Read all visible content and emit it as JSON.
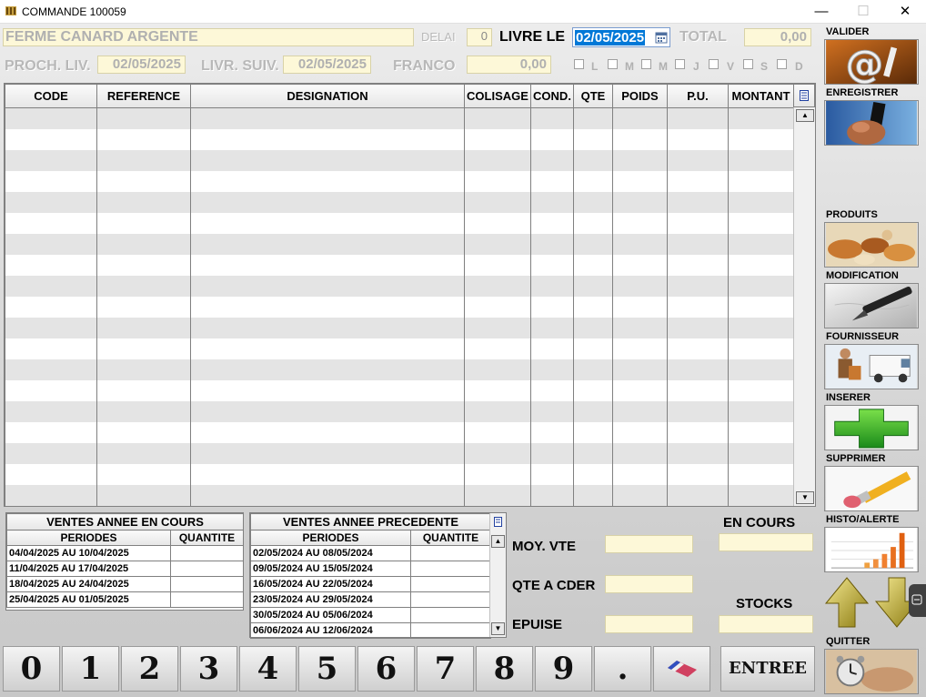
{
  "window": {
    "title": "COMMANDE 100059",
    "min_glyph": "—",
    "max_glyph": "☐",
    "close_glyph": "✕"
  },
  "header": {
    "supplier": "FERME CANARD ARGENTE",
    "delai_label": "DELAI",
    "delai_value": "0",
    "livre_le_label": "LIVRE LE",
    "livre_le_value": "02/05/2025",
    "total_label": "TOTAL",
    "total_value": "0,00",
    "proch_liv_label": "PROCH. LIV.",
    "proch_liv_value": "02/05/2025",
    "livr_suiv_label": "LIVR. SUIV.",
    "livr_suiv_value": "02/05/2025",
    "franco_label": "FRANCO",
    "franco_value": "0,00",
    "days": [
      "L",
      "M",
      "M",
      "J",
      "V",
      "S",
      "D"
    ]
  },
  "grid": {
    "columns": [
      "CODE",
      "REFERENCE",
      "DESIGNATION",
      "COLISAGE",
      "COND.",
      "QTE",
      "POIDS",
      "P.U.",
      "MONTANT"
    ],
    "row_count": 19
  },
  "sidebar": {
    "buttons": [
      {
        "label": "VALIDER",
        "icon": "at-sign-icon"
      },
      {
        "label": "ENREGISTRER",
        "icon": "hand-save-icon"
      },
      {
        "label": "PRODUITS",
        "icon": "bread-icon"
      },
      {
        "label": "MODIFICATION",
        "icon": "pen-icon"
      },
      {
        "label": "FOURNISSEUR",
        "icon": "delivery-truck-icon"
      },
      {
        "label": "INSERER",
        "icon": "green-plus-icon"
      },
      {
        "label": "SUPPRIMER",
        "icon": "eraser-pencil-icon"
      },
      {
        "label": "HISTO/ALERTE",
        "icon": "bar-chart-icon"
      },
      {
        "label": "QUITTER",
        "icon": "alarm-clock-icon"
      }
    ]
  },
  "ventes_en_cours": {
    "title": "VENTES ANNEE EN COURS",
    "col_periodes": "PERIODES",
    "col_quantite": "QUANTITE",
    "rows": [
      {
        "periode": "04/04/2025 AU 10/04/2025",
        "quantite": ""
      },
      {
        "periode": "11/04/2025 AU 17/04/2025",
        "quantite": ""
      },
      {
        "periode": "18/04/2025 AU 24/04/2025",
        "quantite": ""
      },
      {
        "periode": "25/04/2025 AU 01/05/2025",
        "quantite": ""
      }
    ]
  },
  "ventes_precedente": {
    "title": "VENTES ANNEE PRECEDENTE",
    "col_periodes": "PERIODES",
    "col_quantite": "QUANTITE",
    "rows": [
      {
        "periode": "02/05/2024 AU 08/05/2024",
        "quantite": ""
      },
      {
        "periode": "09/05/2024 AU 15/05/2024",
        "quantite": ""
      },
      {
        "periode": "16/05/2024 AU 22/05/2024",
        "quantite": ""
      },
      {
        "periode": "23/05/2024 AU 29/05/2024",
        "quantite": ""
      },
      {
        "periode": "30/05/2024 AU 05/06/2024",
        "quantite": ""
      },
      {
        "periode": "06/06/2024 AU 12/06/2024",
        "quantite": ""
      }
    ]
  },
  "stats": {
    "en_cours_label": "EN COURS",
    "stocks_label": "STOCKS",
    "moy_vte_label": "MOY. VTE",
    "qte_a_cder_label": "QTE A CDER",
    "epuise_label": "EPUISE"
  },
  "keypad": {
    "keys": [
      "0",
      "1",
      "2",
      "3",
      "4",
      "5",
      "6",
      "7",
      "8",
      "9",
      "."
    ],
    "entree_label": "ENTREE"
  },
  "colors": {
    "field_yellow": "#fdf8d8",
    "selection_blue": "#0078d7",
    "row_gray": "#e4e4e4"
  }
}
